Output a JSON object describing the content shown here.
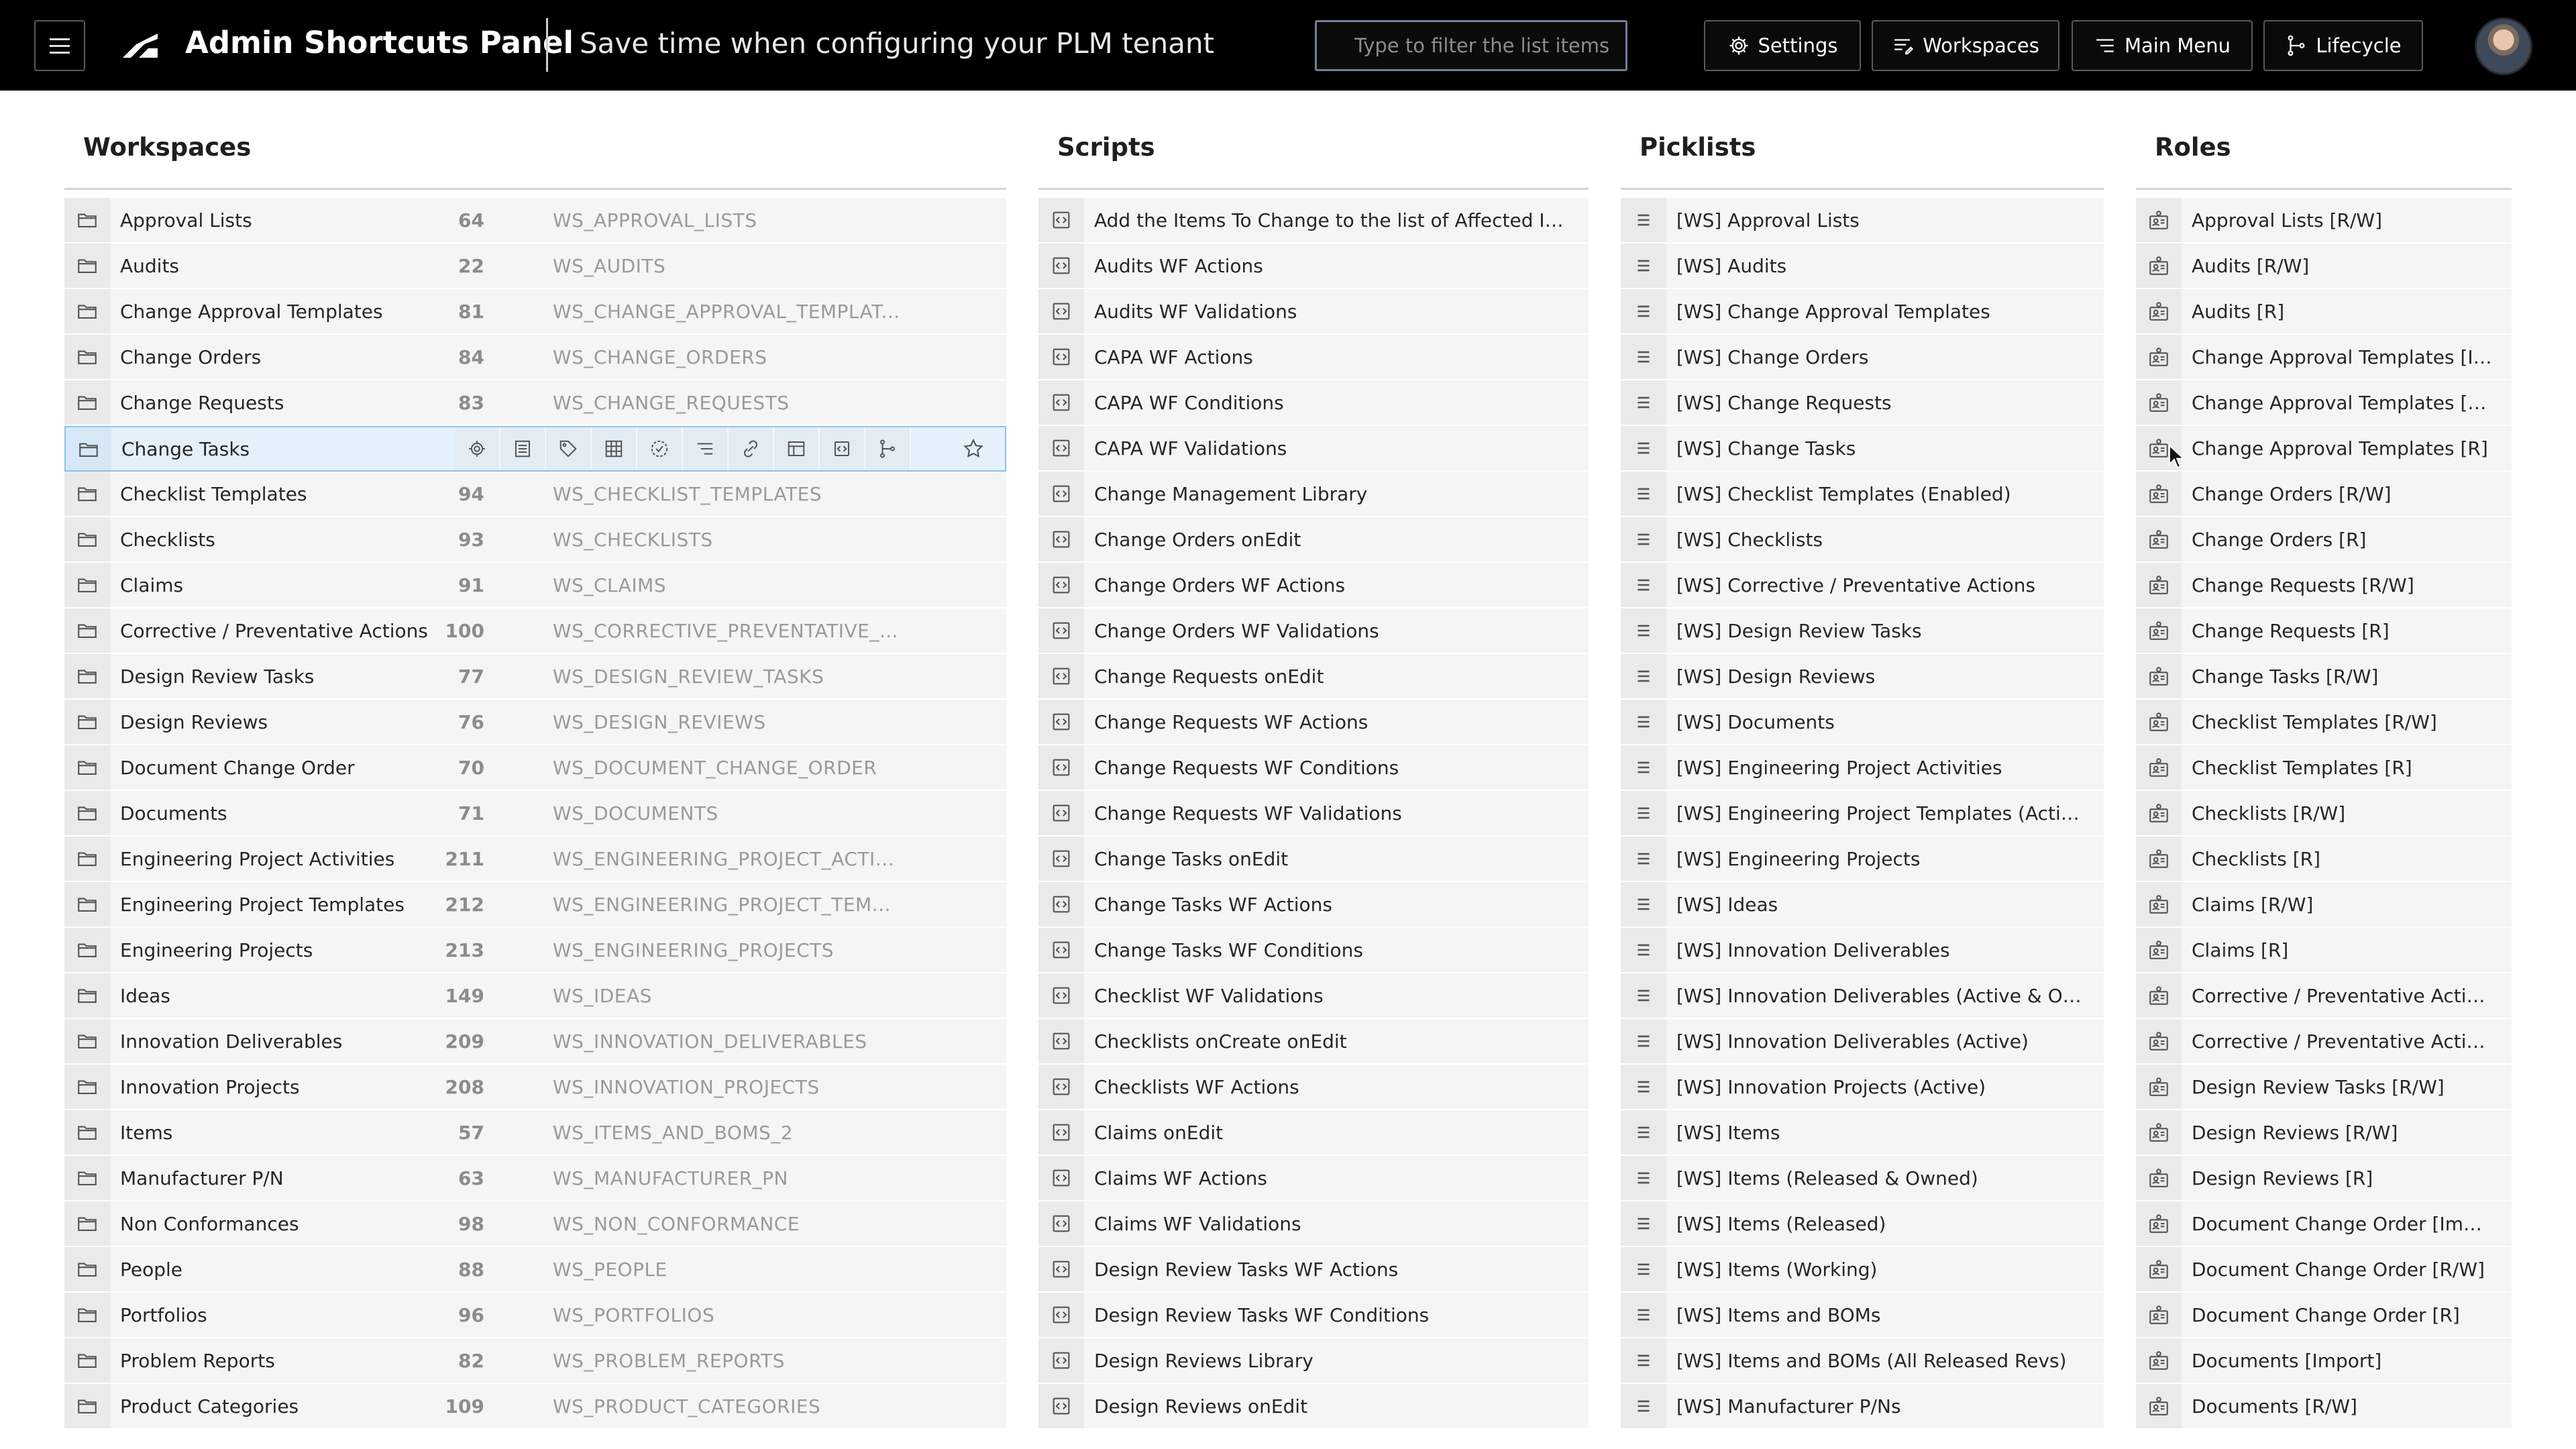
{
  "header": {
    "title": "Admin Shortcuts Panel",
    "subtitle": "Save time when configuring your PLM tenant",
    "filter_placeholder": "Type to filter the list items",
    "buttons": [
      {
        "label": "Settings",
        "icon": "gear-icon"
      },
      {
        "label": "Workspaces",
        "icon": "workspaces-icon"
      },
      {
        "label": "Main Menu",
        "icon": "menu-lines-icon"
      },
      {
        "label": "Lifecycle",
        "icon": "lifecycle-icon"
      }
    ]
  },
  "colors": {
    "header_bg": "#000000",
    "row_bg": "#f5f5f5",
    "selected_bg": "#e4f0fa",
    "selected_border": "#8fc2ea"
  },
  "workspaces": {
    "title": "Workspaces",
    "selected_index": 5,
    "items": [
      {
        "label": "Approval Lists",
        "count": "64",
        "id": "WS_APPROVAL_LISTS"
      },
      {
        "label": "Audits",
        "count": "22",
        "id": "WS_AUDITS"
      },
      {
        "label": "Change Approval Templates",
        "count": "81",
        "id": "WS_CHANGE_APPROVAL_TEMPLAT..."
      },
      {
        "label": "Change Orders",
        "count": "84",
        "id": "WS_CHANGE_ORDERS"
      },
      {
        "label": "Change Requests",
        "count": "83",
        "id": "WS_CHANGE_REQUESTS"
      },
      {
        "label": "Change Tasks",
        "count": "",
        "id": ""
      },
      {
        "label": "Checklist Templates",
        "count": "94",
        "id": "WS_CHECKLIST_TEMPLATES"
      },
      {
        "label": "Checklists",
        "count": "93",
        "id": "WS_CHECKLISTS"
      },
      {
        "label": "Claims",
        "count": "91",
        "id": "WS_CLAIMS"
      },
      {
        "label": "Corrective / Preventative Actions",
        "count": "100",
        "id": "WS_CORRECTIVE_PREVENTATIVE_..."
      },
      {
        "label": "Design Review Tasks",
        "count": "77",
        "id": "WS_DESIGN_REVIEW_TASKS"
      },
      {
        "label": "Design Reviews",
        "count": "76",
        "id": "WS_DESIGN_REVIEWS"
      },
      {
        "label": "Document Change Order",
        "count": "70",
        "id": "WS_DOCUMENT_CHANGE_ORDER"
      },
      {
        "label": "Documents",
        "count": "71",
        "id": "WS_DOCUMENTS"
      },
      {
        "label": "Engineering Project Activities",
        "count": "211",
        "id": "WS_ENGINEERING_PROJECT_ACTI..."
      },
      {
        "label": "Engineering Project Templates",
        "count": "212",
        "id": "WS_ENGINEERING_PROJECT_TEM..."
      },
      {
        "label": "Engineering Projects",
        "count": "213",
        "id": "WS_ENGINEERING_PROJECTS"
      },
      {
        "label": "Ideas",
        "count": "149",
        "id": "WS_IDEAS"
      },
      {
        "label": "Innovation Deliverables",
        "count": "209",
        "id": "WS_INNOVATION_DELIVERABLES"
      },
      {
        "label": "Innovation Projects",
        "count": "208",
        "id": "WS_INNOVATION_PROJECTS"
      },
      {
        "label": "Items",
        "count": "57",
        "id": "WS_ITEMS_AND_BOMS_2"
      },
      {
        "label": "Manufacturer P/N",
        "count": "63",
        "id": "WS_MANUFACTURER_PN"
      },
      {
        "label": "Non Conformances",
        "count": "98",
        "id": "WS_NON_CONFORMANCE"
      },
      {
        "label": "People",
        "count": "88",
        "id": "WS_PEOPLE"
      },
      {
        "label": "Portfolios",
        "count": "96",
        "id": "WS_PORTFOLIOS"
      },
      {
        "label": "Problem Reports",
        "count": "82",
        "id": "WS_PROBLEM_REPORTS"
      },
      {
        "label": "Product Categories",
        "count": "109",
        "id": "WS_PRODUCT_CATEGORIES"
      }
    ],
    "selected_actions": [
      "gear-icon",
      "details-icon",
      "tag-icon",
      "grid-icon",
      "workflow-check-icon",
      "bom-icon",
      "link-icon",
      "table-icon",
      "script-icon",
      "lifecycle-icon"
    ]
  },
  "scripts": {
    "title": "Scripts",
    "items": [
      "Add the Items To Change to the list of Affected Items",
      "Audits WF Actions",
      "Audits WF Validations",
      "CAPA WF Actions",
      "CAPA WF Conditions",
      "CAPA WF Validations",
      "Change Management Library",
      "Change Orders onEdit",
      "Change Orders WF Actions",
      "Change Orders WF Validations",
      "Change Requests onEdit",
      "Change Requests WF Actions",
      "Change Requests WF Conditions",
      "Change Requests WF Validations",
      "Change Tasks onEdit",
      "Change Tasks WF Actions",
      "Change Tasks WF Conditions",
      "Checklist WF Validations",
      "Checklists onCreate onEdit",
      "Checklists WF Actions",
      "Claims onEdit",
      "Claims WF Actions",
      "Claims WF Validations",
      "Design Review Tasks WF Actions",
      "Design Review Tasks WF Conditions",
      "Design Reviews Library",
      "Design Reviews onEdit"
    ]
  },
  "picklists": {
    "title": "Picklists",
    "items": [
      "[WS] Approval Lists",
      "[WS] Audits",
      "[WS] Change Approval Templates",
      "[WS] Change Orders",
      "[WS] Change Requests",
      "[WS] Change Tasks",
      "[WS] Checklist Templates (Enabled)",
      "[WS] Checklists",
      "[WS] Corrective / Preventative Actions",
      "[WS] Design Review Tasks",
      "[WS] Design Reviews",
      "[WS] Documents",
      "[WS] Engineering Project Activities",
      "[WS] Engineering Project Templates (Active)",
      "[WS] Engineering Projects",
      "[WS] Ideas",
      "[WS] Innovation Deliverables",
      "[WS] Innovation Deliverables (Active & Own...",
      "[WS] Innovation Deliverables (Active)",
      "[WS] Innovation Projects (Active)",
      "[WS] Items",
      "[WS] Items (Released & Owned)",
      "[WS] Items (Released)",
      "[WS] Items (Working)",
      "[WS] Items and BOMs",
      "[WS] Items and BOMs (All Released Revs)",
      "[WS] Manufacturer P/Ns"
    ]
  },
  "roles": {
    "title": "Roles",
    "items": [
      "Approval Lists [R/W]",
      "Audits [R/W]",
      "Audits [R]",
      "Change Approval Templates [Im...",
      "Change Approval Templates [R/W]",
      "Change Approval Templates [R]",
      "Change Orders [R/W]",
      "Change Orders [R]",
      "Change Requests [R/W]",
      "Change Requests [R]",
      "Change Tasks [R/W]",
      "Checklist Templates [R/W]",
      "Checklist Templates [R]",
      "Checklists [R/W]",
      "Checklists [R]",
      "Claims [R/W]",
      "Claims [R]",
      "Corrective / Preventative Actions...",
      "Corrective / Preventative Actions...",
      "Design Review Tasks [R/W]",
      "Design Reviews [R/W]",
      "Design Reviews [R]",
      "Document Change Order [Import]",
      "Document Change Order [R/W]",
      "Document Change Order [R]",
      "Documents [Import]",
      "Documents [R/W]"
    ]
  }
}
